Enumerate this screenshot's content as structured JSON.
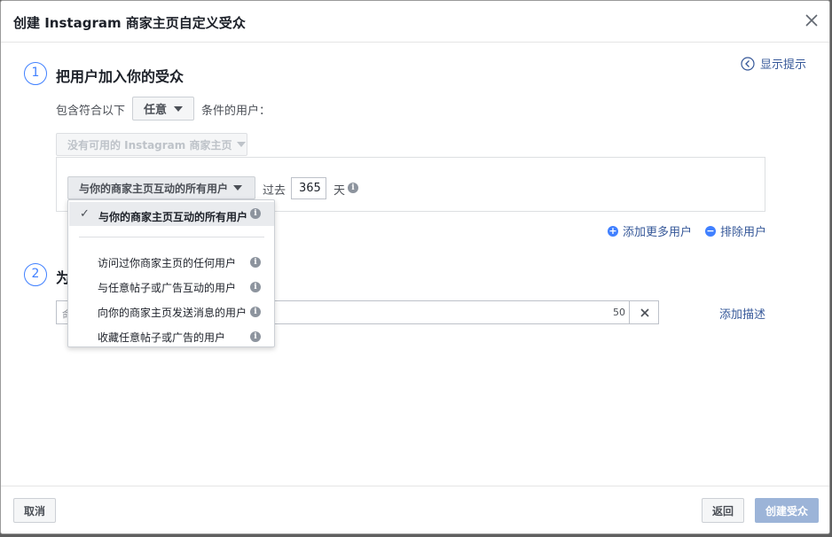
{
  "dialog": {
    "title": "创建 Instagram 商家主页自定义受众",
    "show_tips": "显示提示"
  },
  "step1": {
    "number": "1",
    "title": "把用户加入你的受众",
    "include_prefix": "包含符合以下",
    "include_selector": "任意",
    "include_suffix": "条件的用户：",
    "account_selector": "没有可用的 Instagram 商家主页",
    "rule": {
      "selected_option": "与你的商家主页互动的所有用户",
      "past_label": "过去",
      "days": "365",
      "days_unit": "天"
    },
    "add_more": "添加更多用户",
    "exclude": "排除用户"
  },
  "dropdown": {
    "selected": "与你的商家主页互动的所有用户",
    "options": [
      "访问过你商家主页的任何用户",
      "与任意帖子或广告互动的用户",
      "向你的商家主页发送消息的用户",
      "收藏任意帖子或广告的用户"
    ]
  },
  "step2": {
    "number": "2",
    "title_visible": "为",
    "name_placeholder_visible": "命",
    "name_char_count": "50",
    "add_description": "添加描述"
  },
  "footer": {
    "cancel": "取消",
    "back": "返回",
    "create": "创建受众"
  }
}
